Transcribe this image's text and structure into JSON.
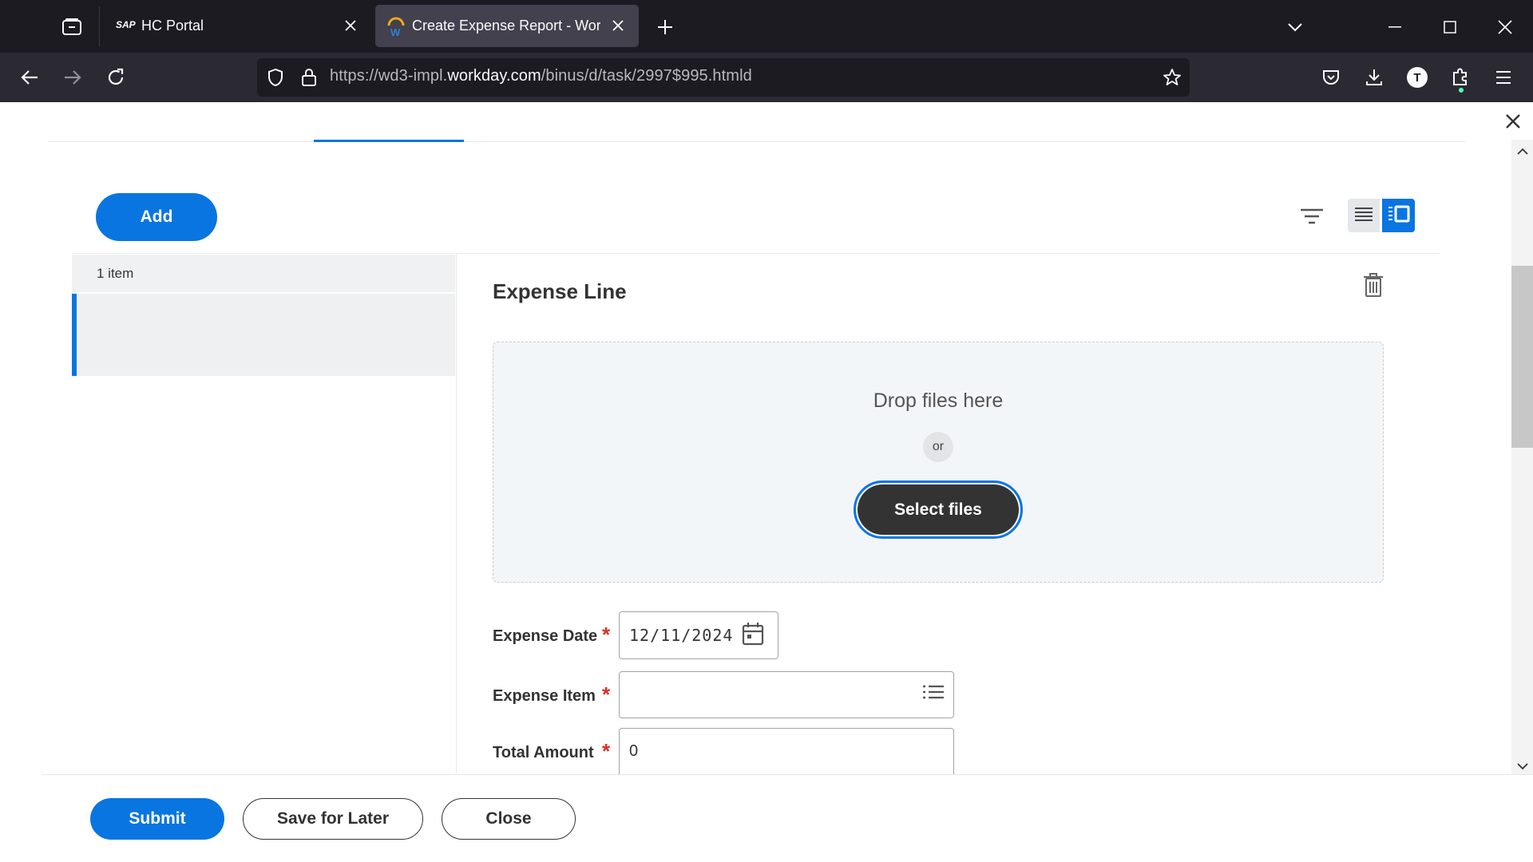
{
  "browser": {
    "tabs": [
      {
        "label": "HC Portal",
        "favicon": "sap-logo-icon",
        "favicon_text": "SAP",
        "active": false
      },
      {
        "label": "Create Expense Report - Workd",
        "favicon": "workday-logo-icon",
        "active": true
      }
    ],
    "url": {
      "prefix": "https://wd3-impl.",
      "domain": "workday.com",
      "path": "/binus/d/task/2997$995.htmld"
    },
    "profile_initial": "T"
  },
  "toolbar": {
    "add_label": "Add",
    "icons": [
      "filter-icon",
      "list-view-icon",
      "card-view-icon"
    ]
  },
  "item_list": {
    "count_label": "1 item"
  },
  "expense_line": {
    "title": "Expense Line",
    "dropzone": {
      "drop_text": "Drop files here",
      "or_text": "or",
      "select_label": "Select files"
    },
    "fields": {
      "expense_date": {
        "label": "Expense Date",
        "required_mark": "*",
        "value": "12/11/2024"
      },
      "expense_item": {
        "label": "Expense Item",
        "required_mark": "*",
        "value": ""
      },
      "total_amount": {
        "label": "Total Amount",
        "required_mark": "*",
        "value": "0"
      }
    }
  },
  "footer": {
    "submit_label": "Submit",
    "save_label": "Save for Later",
    "close_label": "Close"
  },
  "colors": {
    "accent": "#0875e1",
    "required": "#de2e21",
    "dark_button": "#333333"
  }
}
